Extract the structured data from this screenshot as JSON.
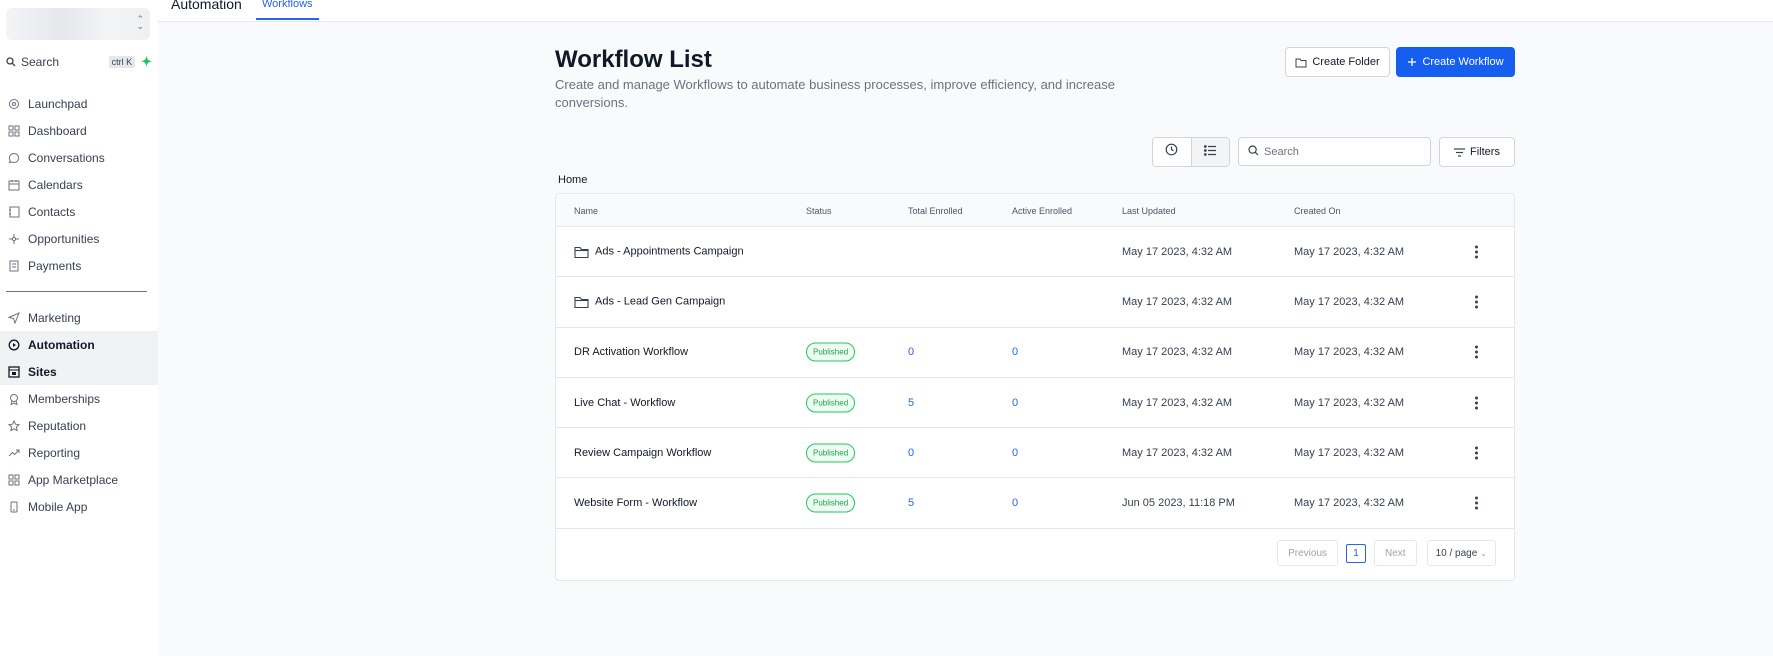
{
  "topbar": {
    "section": "Automation",
    "active_tab": "Workflows"
  },
  "sidebar": {
    "search_placeholder": "Search",
    "shortcut": "ctrl K",
    "items": [
      {
        "label": "Launchpad",
        "icon": "rocket-icon"
      },
      {
        "label": "Dashboard",
        "icon": "grid-icon"
      },
      {
        "label": "Conversations",
        "icon": "chat-icon"
      },
      {
        "label": "Calendars",
        "icon": "calendar-icon"
      },
      {
        "label": "Contacts",
        "icon": "contacts-icon"
      },
      {
        "label": "Opportunities",
        "icon": "opportunities-icon"
      },
      {
        "label": "Payments",
        "icon": "payments-icon"
      }
    ],
    "items2": [
      {
        "label": "Marketing",
        "icon": "send-icon"
      },
      {
        "label": "Automation",
        "icon": "automation-icon"
      },
      {
        "label": "Sites",
        "icon": "sites-icon"
      },
      {
        "label": "Memberships",
        "icon": "badge-icon"
      },
      {
        "label": "Reputation",
        "icon": "star-icon"
      },
      {
        "label": "Reporting",
        "icon": "trend-icon"
      },
      {
        "label": "App Marketplace",
        "icon": "apps-icon"
      },
      {
        "label": "Mobile App",
        "icon": "mobile-icon"
      }
    ]
  },
  "header": {
    "title": "Workflow List",
    "subtitle": "Create and manage Workflows to automate business processes, improve efficiency, and increase conversions.",
    "create_folder": "Create Folder",
    "create_workflow": "Create Workflow"
  },
  "toolbar": {
    "search_placeholder": "Search",
    "filters": "Filters"
  },
  "breadcrumb": "Home",
  "table": {
    "columns": [
      "Name",
      "Status",
      "Total Enrolled",
      "Active Enrolled",
      "Last Updated",
      "Created On"
    ],
    "rows": [
      {
        "name": "Ads - Appointments Campaign",
        "folder": true,
        "status": "",
        "total": "",
        "active": "",
        "updated": "May 17 2023, 4:32 AM",
        "created": "May 17 2023, 4:32 AM"
      },
      {
        "name": "Ads - Lead Gen Campaign",
        "folder": true,
        "status": "",
        "total": "",
        "active": "",
        "updated": "May 17 2023, 4:32 AM",
        "created": "May 17 2023, 4:32 AM"
      },
      {
        "name": "DR Activation Workflow",
        "folder": false,
        "status": "Published",
        "total": "0",
        "active": "0",
        "updated": "May 17 2023, 4:32 AM",
        "created": "May 17 2023, 4:32 AM"
      },
      {
        "name": "Live Chat - Workflow",
        "folder": false,
        "status": "Published",
        "total": "5",
        "active": "0",
        "updated": "May 17 2023, 4:32 AM",
        "created": "May 17 2023, 4:32 AM"
      },
      {
        "name": "Review Campaign Workflow",
        "folder": false,
        "status": "Published",
        "total": "0",
        "active": "0",
        "updated": "May 17 2023, 4:32 AM",
        "created": "May 17 2023, 4:32 AM"
      },
      {
        "name": "Website Form - Workflow",
        "folder": false,
        "status": "Published",
        "total": "5",
        "active": "0",
        "updated": "Jun 05 2023, 11:18 PM",
        "created": "May 17 2023, 4:32 AM"
      }
    ]
  },
  "pagination": {
    "previous": "Previous",
    "page": "1",
    "next": "Next",
    "page_size": "10 / page"
  },
  "colors": {
    "primary": "#155eef",
    "link": "#2563eb",
    "success": "#16a34a"
  }
}
